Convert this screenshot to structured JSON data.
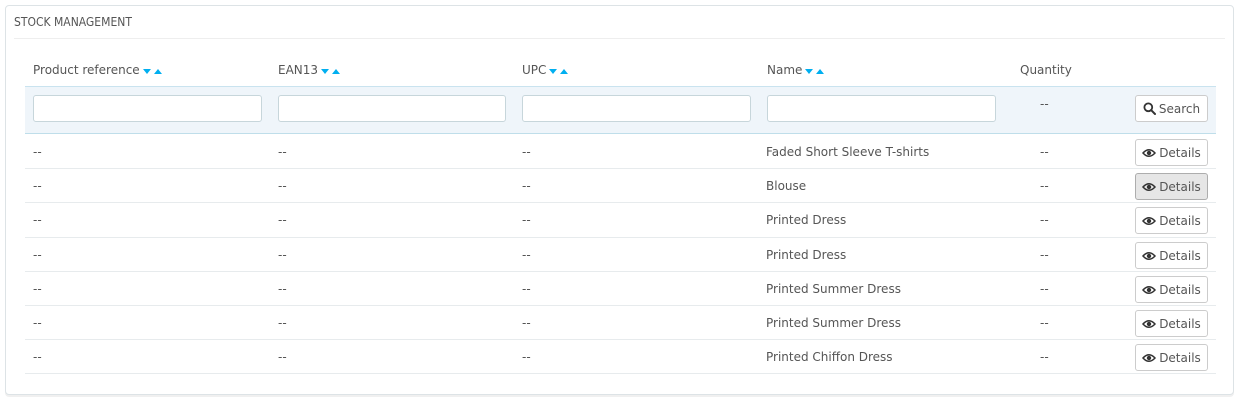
{
  "panel": {
    "title": "STOCK MANAGEMENT"
  },
  "columns": [
    {
      "key": "reference",
      "label": "Product reference",
      "sortable": true
    },
    {
      "key": "ean13",
      "label": "EAN13",
      "sortable": true
    },
    {
      "key": "upc",
      "label": "UPC",
      "sortable": true
    },
    {
      "key": "name",
      "label": "Name",
      "sortable": true
    },
    {
      "key": "quantity",
      "label": "Quantity",
      "sortable": false
    }
  ],
  "filters": {
    "reference": "",
    "ean13": "",
    "upc": "",
    "name": "",
    "quantity": "--",
    "search_label": "Search"
  },
  "rows": [
    {
      "reference": "--",
      "ean13": "--",
      "upc": "--",
      "name": "Faded Short Sleeve T-shirts",
      "quantity": "--",
      "action": "Details"
    },
    {
      "reference": "--",
      "ean13": "--",
      "upc": "--",
      "name": "Blouse",
      "quantity": "--",
      "action": "Details"
    },
    {
      "reference": "--",
      "ean13": "--",
      "upc": "--",
      "name": "Printed Dress",
      "quantity": "--",
      "action": "Details"
    },
    {
      "reference": "--",
      "ean13": "--",
      "upc": "--",
      "name": "Printed Dress",
      "quantity": "--",
      "action": "Details"
    },
    {
      "reference": "--",
      "ean13": "--",
      "upc": "--",
      "name": "Printed Summer Dress",
      "quantity": "--",
      "action": "Details"
    },
    {
      "reference": "--",
      "ean13": "--",
      "upc": "--",
      "name": "Printed Summer Dress",
      "quantity": "--",
      "action": "Details"
    },
    {
      "reference": "--",
      "ean13": "--",
      "upc": "--",
      "name": "Printed Chiffon Dress",
      "quantity": "--",
      "action": "Details"
    }
  ],
  "icons": {
    "sort_desc": "caret-down-icon",
    "sort_asc": "caret-up-icon",
    "search": "search-icon",
    "details": "eye-icon"
  },
  "colors": {
    "accent": "#00aff0",
    "filter_bg": "#eff5fa"
  }
}
